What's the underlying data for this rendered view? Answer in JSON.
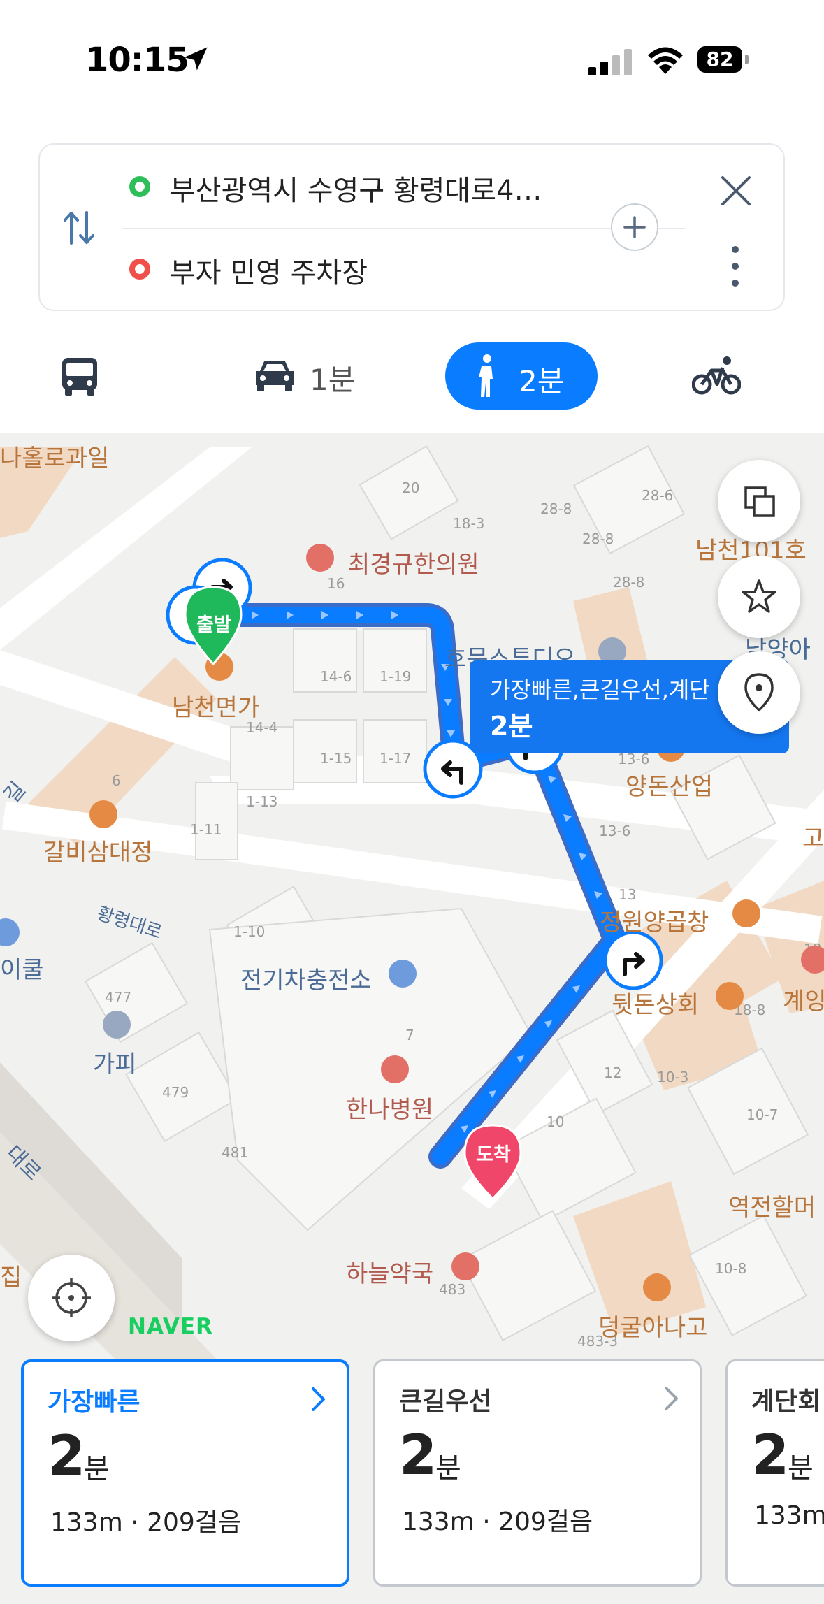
{
  "status": {
    "time": "10:15",
    "battery": "82"
  },
  "route": {
    "start": "부산광역시 수영구 황령대로4…",
    "end": "부자 민영 주차장"
  },
  "modes": {
    "car_time": "1분",
    "walk_time": "2분"
  },
  "map": {
    "route_label_line1": "가장빠른,큰길우선,계단",
    "route_label_line2": "2분",
    "start_marker": "출발",
    "end_marker": "도착",
    "pois": [
      {
        "key": "p1",
        "text": "나홀로과일"
      },
      {
        "key": "p2",
        "text": "최경규한의원"
      },
      {
        "key": "p3",
        "text": "남천101호"
      },
      {
        "key": "p4",
        "text": "남천면가"
      },
      {
        "key": "p5",
        "text": "남양아"
      },
      {
        "key": "p6",
        "text": "호문스튜디오"
      },
      {
        "key": "p7",
        "text": "양돈산업"
      },
      {
        "key": "p8",
        "text": "갈비삼대정"
      },
      {
        "key": "p9",
        "text": "정원양곱창"
      },
      {
        "key": "p10",
        "text": "전기차충전소"
      },
      {
        "key": "p11",
        "text": "뒷돈상회"
      },
      {
        "key": "p12",
        "text": "계잉"
      },
      {
        "key": "p13",
        "text": "가피"
      },
      {
        "key": "p14",
        "text": "한나병원"
      },
      {
        "key": "p15",
        "text": "역전할머"
      },
      {
        "key": "p16",
        "text": "하늘약국"
      },
      {
        "key": "p17",
        "text": "덩굴아나고"
      },
      {
        "key": "p18",
        "text": "이쿨"
      },
      {
        "key": "p19",
        "text": "고"
      },
      {
        "key": "p20",
        "text": "집"
      }
    ],
    "roads": {
      "r1": "황령대로",
      "r2": "길",
      "r3": "대로"
    },
    "brand": "NAVER"
  },
  "cards": [
    {
      "title": "가장빠른",
      "time": "2",
      "unit": "분",
      "dist": "133m · 209걸음"
    },
    {
      "title": "큰길우선",
      "time": "2",
      "unit": "분",
      "dist": "133m · 209걸음"
    },
    {
      "title": "계단회",
      "time": "2",
      "unit": "분",
      "dist": "133m"
    }
  ]
}
